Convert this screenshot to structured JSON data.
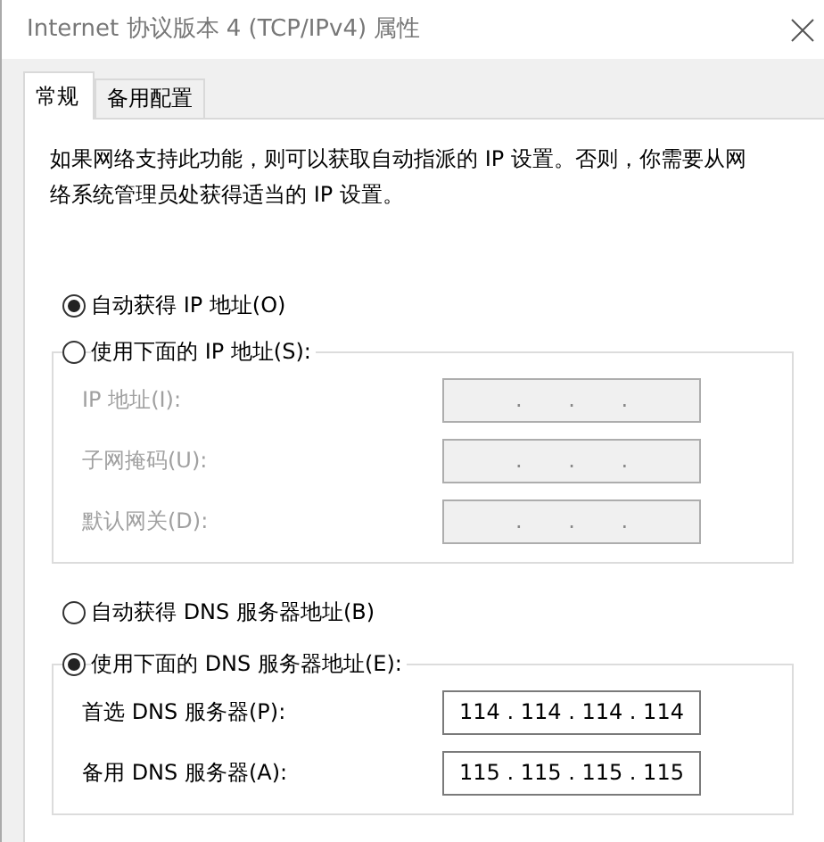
{
  "window": {
    "title": "Internet 协议版本 4 (TCP/IPv4) 属性"
  },
  "tabs": [
    {
      "label": "常规",
      "selected": true
    },
    {
      "label": "备用配置",
      "selected": false
    }
  ],
  "description": "如果网络支持此功能，则可以获取自动指派的 IP 设置。否则，你需要从网络系统管理员处获得适当的 IP 设置。",
  "ip_options": [
    {
      "kind": "plain",
      "label": "自动获得 IP 地址(O)",
      "selected": true
    },
    {
      "kind": "group",
      "label": "使用下面的 IP 地址(S):",
      "selected": false,
      "fields": [
        {
          "label": "IP 地址(I):",
          "value": ". . .",
          "disabled": true
        },
        {
          "label": "子网掩码(U):",
          "value": ". . .",
          "disabled": true
        },
        {
          "label": "默认网关(D):",
          "value": ". . .",
          "disabled": true
        }
      ]
    }
  ],
  "dns_options": [
    {
      "kind": "plain",
      "label": "自动获得 DNS 服务器地址(B)",
      "selected": false
    },
    {
      "kind": "group",
      "label": "使用下面的 DNS 服务器地址(E):",
      "selected": true,
      "fields": [
        {
          "label": "首选 DNS 服务器(P):",
          "value": "114 . 114 . 114 . 114",
          "disabled": false
        },
        {
          "label": "备用 DNS 服务器(A):",
          "value": "115 . 115 . 115 . 115",
          "disabled": false
        }
      ]
    }
  ]
}
